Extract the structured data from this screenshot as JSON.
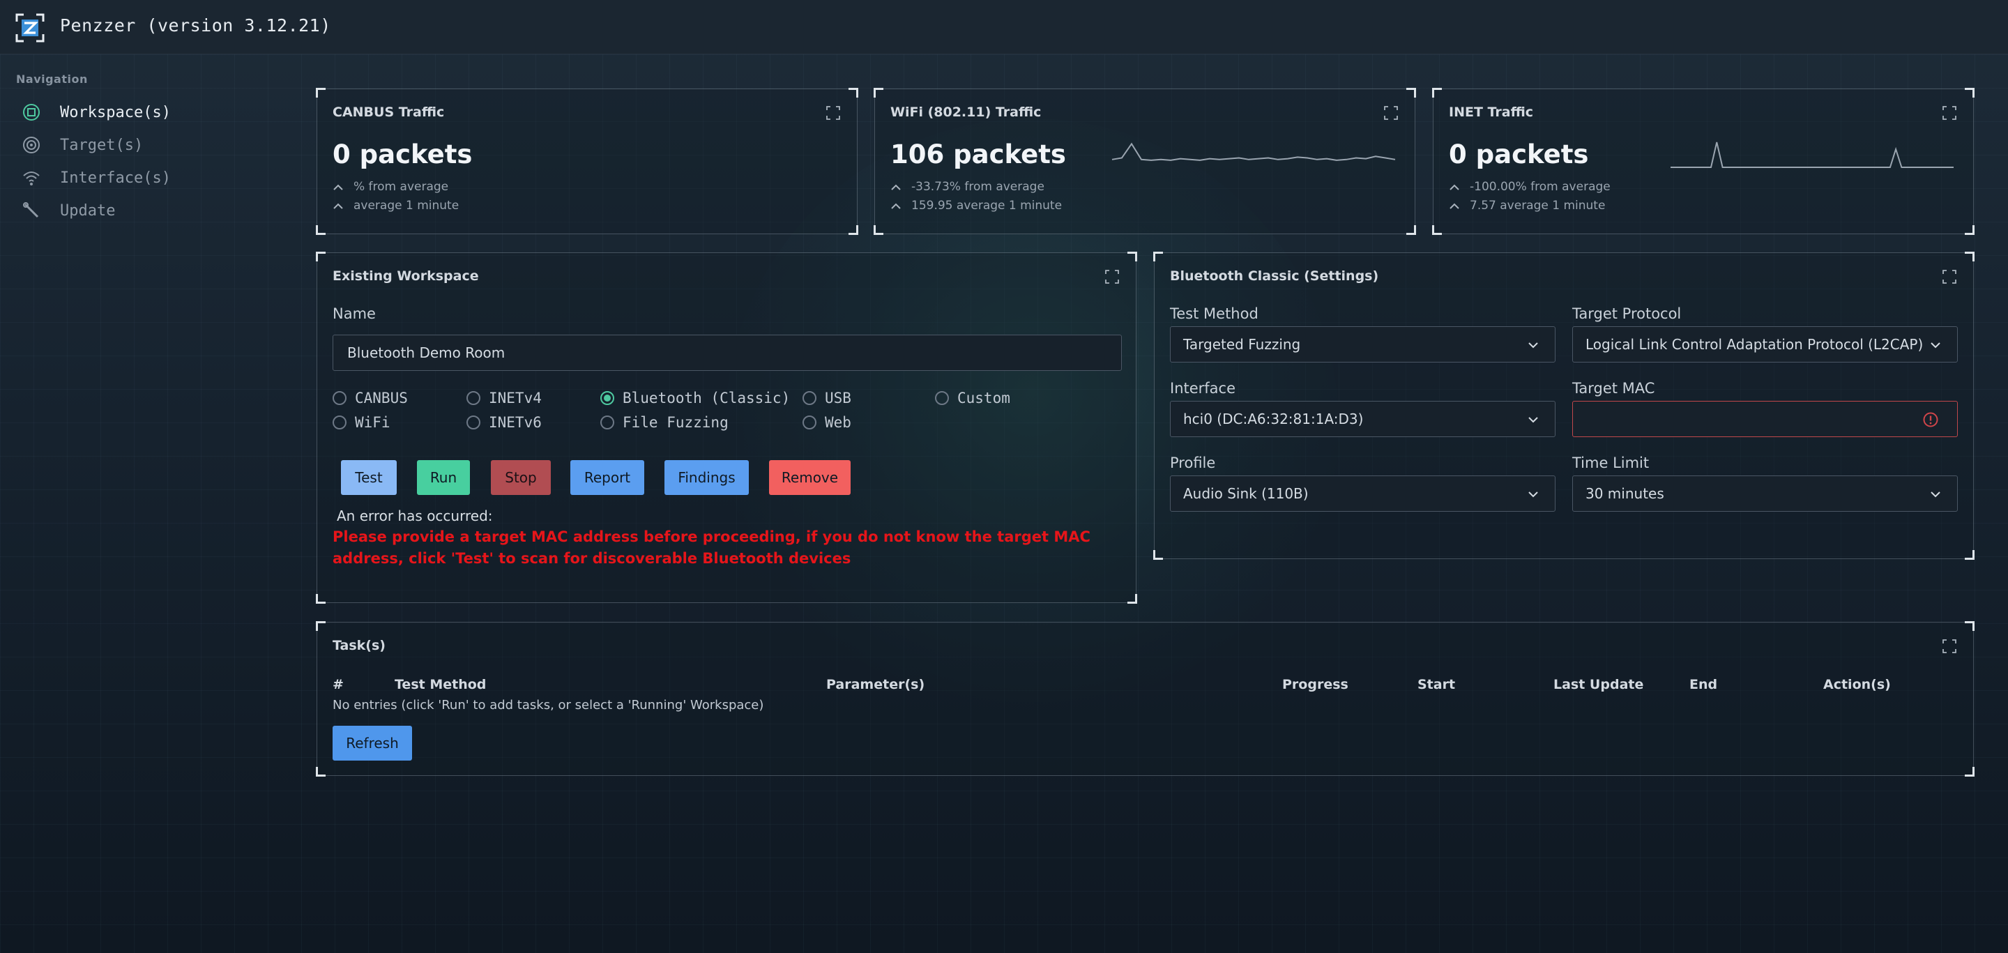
{
  "app": {
    "title": "Penzzer (version 3.12.21)"
  },
  "nav": {
    "heading": "Navigation",
    "items": [
      {
        "label": "Workspace(s)",
        "icon": "workspace-icon",
        "active": true
      },
      {
        "label": "Target(s)",
        "icon": "target-icon",
        "active": false
      },
      {
        "label": "Interface(s)",
        "icon": "wifi-icon",
        "active": false
      },
      {
        "label": "Update",
        "icon": "wrench-icon",
        "active": false
      }
    ]
  },
  "traffic": [
    {
      "title": "CANBUS Traffic",
      "count": "0 packets",
      "line1": "% from average",
      "line2": "average 1 minute",
      "sparkline": []
    },
    {
      "title": "WiFi (802.11) Traffic",
      "count": "106 packets",
      "line1": "-33.73% from average",
      "line2": "159.95 average 1 minute",
      "sparkline": [
        10,
        12,
        30,
        10,
        9,
        10,
        9,
        11,
        10,
        9,
        11,
        10,
        11,
        12,
        10,
        11,
        12,
        10,
        11,
        13,
        12,
        10,
        11,
        9,
        10,
        12,
        11,
        14,
        12,
        10
      ]
    },
    {
      "title": "INET Traffic",
      "count": "0 packets",
      "line1": "-100.00% from average",
      "line2": "7.57 average 1 minute",
      "sparkline": [
        0,
        0,
        0,
        0,
        0,
        0,
        0,
        0,
        36,
        0,
        0,
        0,
        0,
        0,
        0,
        0,
        0,
        0,
        0,
        0,
        0,
        0,
        0,
        0,
        0,
        0,
        0,
        0,
        0,
        0,
        0,
        0,
        0,
        0,
        0,
        0,
        0,
        0,
        0,
        26,
        0,
        0,
        0,
        0,
        0,
        0,
        0,
        0,
        0,
        0
      ]
    }
  ],
  "workspace": {
    "title": "Existing Workspace",
    "name_label": "Name",
    "name_value": "Bluetooth Demo Room",
    "radios": [
      {
        "label": "CANBUS",
        "checked": false
      },
      {
        "label": "INETv4",
        "checked": false
      },
      {
        "label": "Bluetooth (Classic)",
        "checked": true
      },
      {
        "label": "USB",
        "checked": false
      },
      {
        "label": "Custom",
        "checked": false
      },
      {
        "label": "WiFi",
        "checked": false
      },
      {
        "label": "INETv6",
        "checked": false
      },
      {
        "label": "File Fuzzing",
        "checked": false
      },
      {
        "label": "Web",
        "checked": false
      }
    ],
    "buttons": {
      "test": "Test",
      "run": "Run",
      "stop": "Stop",
      "report": "Report",
      "findings": "Findings",
      "remove": "Remove"
    },
    "error_head": "An error has occurred:",
    "error_msg": "Please provide a target MAC address before proceeding, if you do not know the target MAC address, click 'Test' to scan for discoverable Bluetooth devices"
  },
  "settings": {
    "title": "Bluetooth Classic (Settings)",
    "test_method_label": "Test Method",
    "test_method_value": "Targeted Fuzzing",
    "target_protocol_label": "Target Protocol",
    "target_protocol_value": "Logical Link Control Adaptation Protocol (L2CAP)",
    "interface_label": "Interface",
    "interface_value": "hci0 (DC:A6:32:81:1A:D3)",
    "target_mac_label": "Target MAC",
    "target_mac_value": "",
    "profile_label": "Profile",
    "profile_value": "Audio Sink (110B)",
    "time_limit_label": "Time Limit",
    "time_limit_value": "30 minutes"
  },
  "tasks": {
    "title": "Task(s)",
    "columns": [
      "#",
      "Test Method",
      "Parameter(s)",
      "Progress",
      "Start",
      "Last Update",
      "End",
      "Action(s)"
    ],
    "empty_text": "No entries (click 'Run' to add tasks, or select a 'Running' Workspace)",
    "refresh_label": "Refresh"
  },
  "colors": {
    "test": "#8ab9f5",
    "run": "#48cf9f",
    "stop": "#b14d52",
    "report": "#5b9ef0",
    "findings": "#5b9ef0",
    "remove": "#f2605f",
    "refresh": "#4f97ec",
    "error": "#e6151a",
    "accent": "#4ec9a0"
  }
}
